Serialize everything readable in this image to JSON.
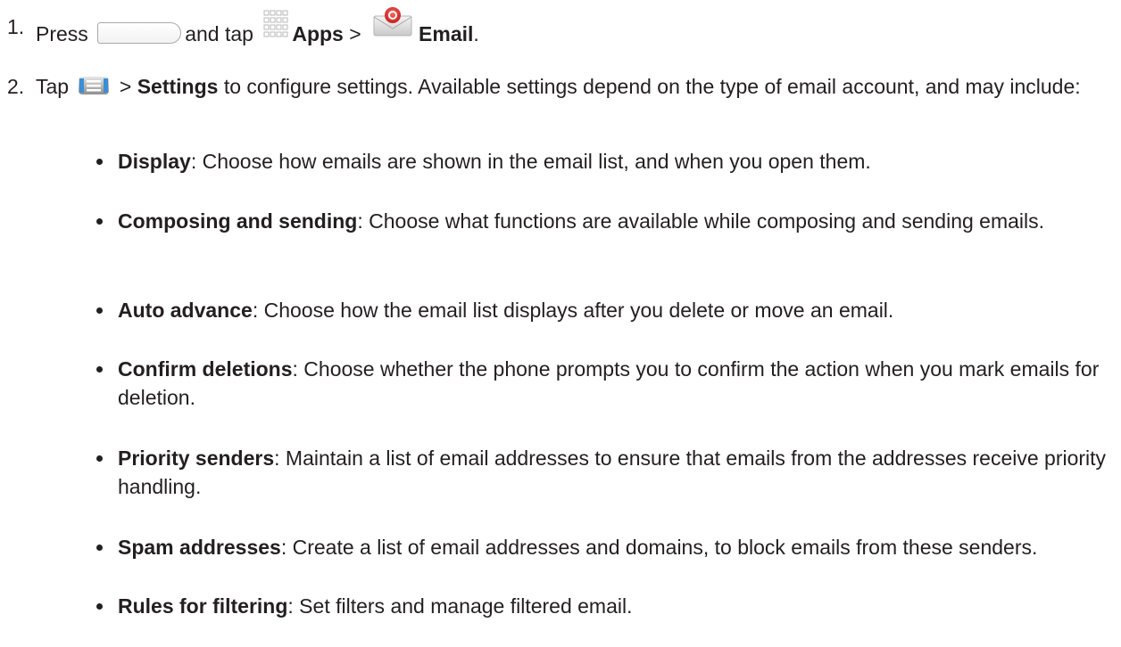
{
  "steps": [
    {
      "number": "1.",
      "parts": {
        "press": "Press",
        "and_tap": "and tap",
        "apps": "Apps",
        "sep": ">",
        "email": "Email",
        "end": "."
      }
    },
    {
      "number": "2.",
      "parts": {
        "tap": "Tap",
        "sep": ">",
        "settings": "Settings",
        "rest": "to configure settings. Available settings depend on the type of email account, and may include:"
      }
    }
  ],
  "bullets": [
    {
      "term": "Display",
      "desc": ": Choose how emails are shown in the email list, and when you open them."
    },
    {
      "term": "Composing and sending",
      "desc": ": Choose what functions are available while composing and sending emails."
    },
    {
      "term": "Auto advance",
      "desc": ": Choose how the email list displays after you delete or move an email."
    },
    {
      "term": "Confirm deletions",
      "desc": ": Choose whether the phone prompts you to confirm the action when you mark emails for deletion."
    },
    {
      "term": "Priority senders",
      "desc": ": Maintain a list of email addresses to ensure that emails from the addresses receive priority handling."
    },
    {
      "term": "Spam addresses",
      "desc": ": Create a list of email addresses and domains, to block emails from these senders."
    },
    {
      "term": "Rules for filtering",
      "desc": ": Set filters and manage filtered email."
    }
  ],
  "icons": {
    "home_key": "home-key-icon",
    "apps": "apps-grid-icon",
    "email": "email-app-icon",
    "menu": "menu-key-icon"
  },
  "colors": {
    "text": "#231f20",
    "email_red": "#d9342b",
    "menu_blue": "#3a8fd6"
  }
}
